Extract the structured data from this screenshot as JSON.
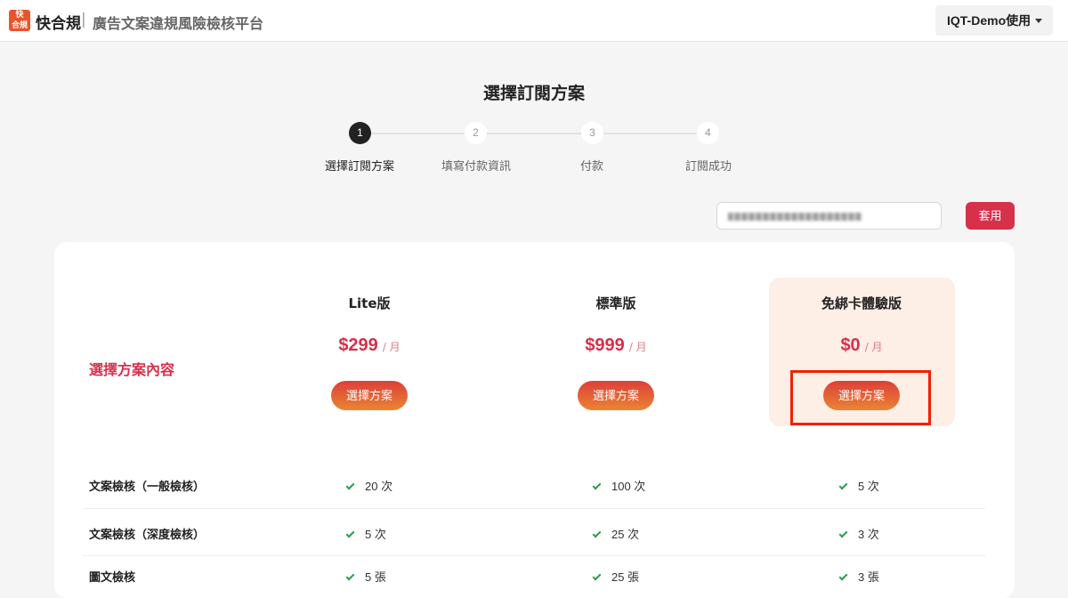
{
  "header": {
    "logo_text": "快合規",
    "brand": "快合規",
    "separator": "|",
    "subtitle": "廣告文案違規風險檢核平台",
    "account_label": "IQT-Demo使用"
  },
  "page_title": "選擇訂閱方案",
  "steps": [
    {
      "number": "1",
      "label": "選擇訂閱方案",
      "active": true
    },
    {
      "number": "2",
      "label": "填寫付款資訊",
      "active": false
    },
    {
      "number": "3",
      "label": "付款",
      "active": false
    },
    {
      "number": "4",
      "label": "訂閱成功",
      "active": false
    }
  ],
  "coupon": {
    "apply_label": "套用"
  },
  "plans_section": {
    "row_title": "選擇方案內容",
    "select_label": "選擇方案",
    "per_unit": "/ 月",
    "plans": [
      {
        "name": "Lite版",
        "price": "$299",
        "highlighted": false
      },
      {
        "name": "標準版",
        "price": "$999",
        "highlighted": false
      },
      {
        "name": "免綁卡體驗版",
        "price": "$0",
        "highlighted": true
      }
    ]
  },
  "features": [
    {
      "label": "文案檢核（一般檢核）",
      "values": [
        "20 次",
        "100 次",
        "5 次"
      ]
    },
    {
      "label": "文案檢核（深度檢核）",
      "values": [
        "5 次",
        "25 次",
        "3 次"
      ]
    },
    {
      "label": "圖文檢核",
      "values": [
        "5 張",
        "25 張",
        "3 張"
      ]
    }
  ],
  "colors": {
    "accent": "#d6304a",
    "button_gradient_start": "#dd3f3a",
    "button_gradient_end": "#e98533",
    "highlight_bg": "#fdeee6",
    "annotation_outline": "#ee2200",
    "check": "#2a9d4a"
  }
}
